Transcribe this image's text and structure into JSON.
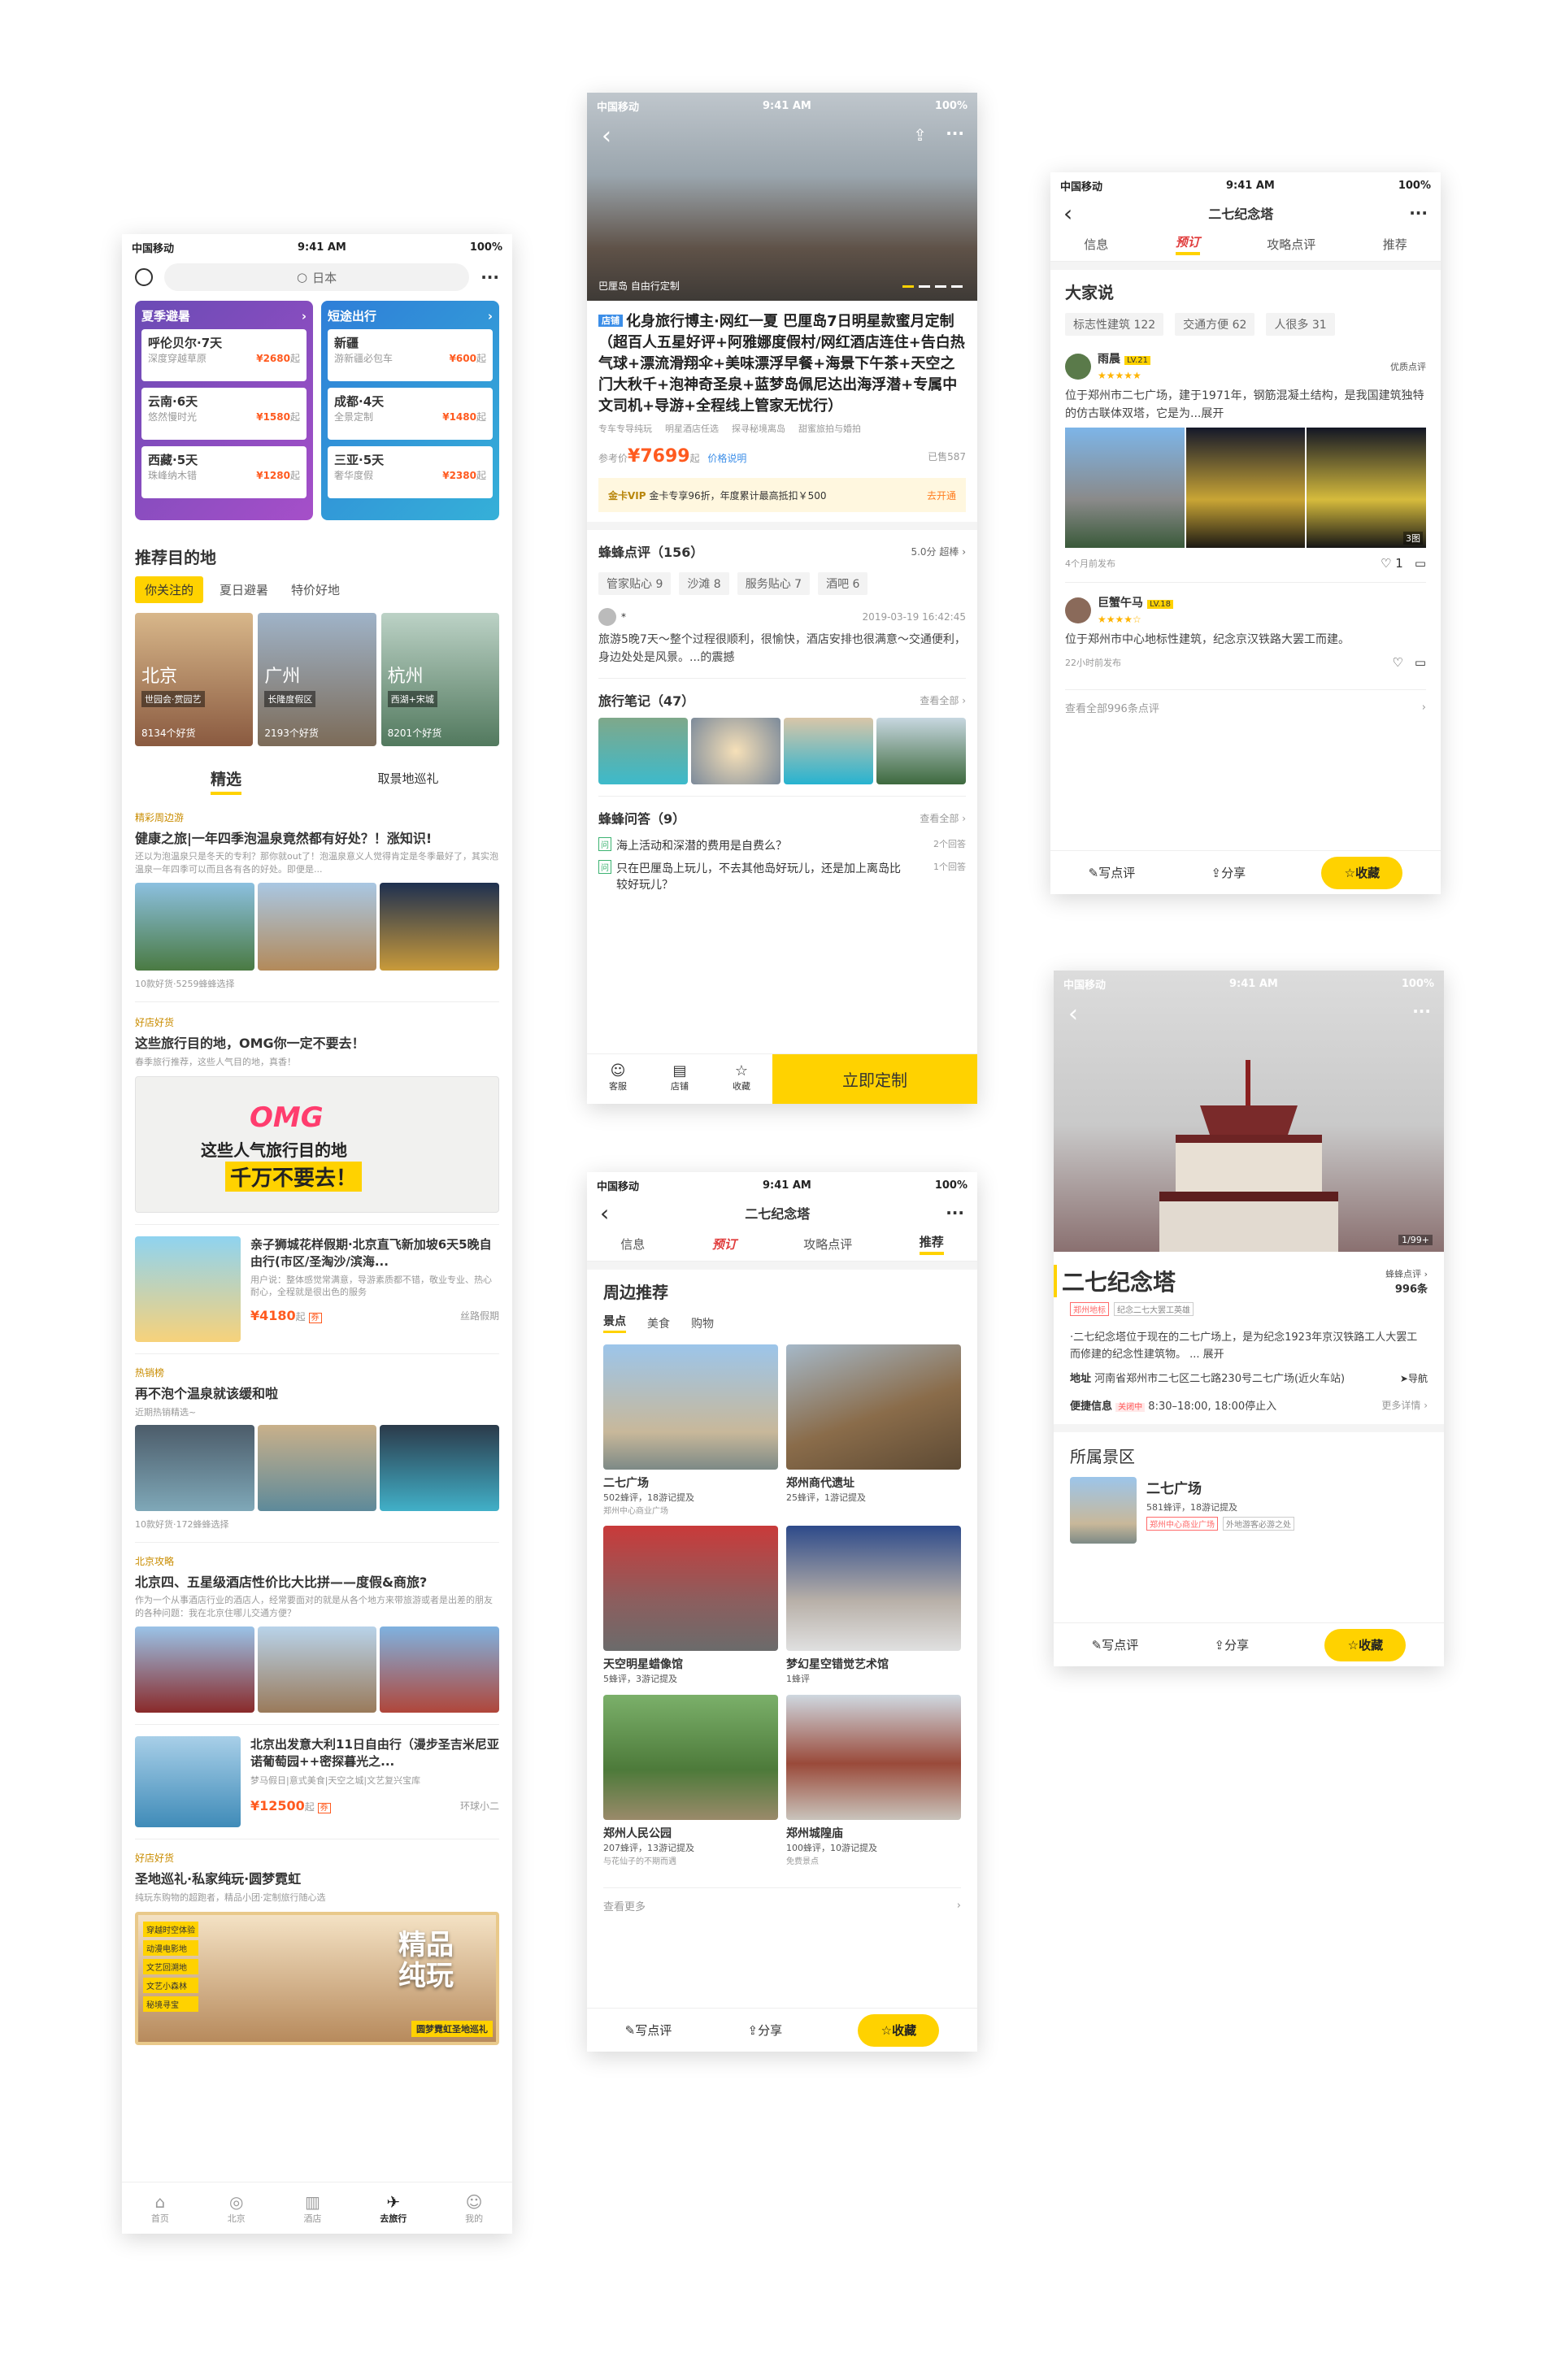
{
  "colors": {
    "accent": "#ffd200",
    "price": "#ff5a1f",
    "blue_tag": "#3c8ee8",
    "muted": "#9a9a9a"
  },
  "status": {
    "carrier": "中国移动",
    "time": "9:41 AM",
    "battery": "100%"
  },
  "screen1": {
    "search_placeholder": "日本",
    "more": "···",
    "cards": [
      {
        "title": "夏季避暑",
        "items": [
          {
            "name": "呼伦贝尔·7天",
            "desc": "深度穿越草原",
            "price": "¥2680",
            "unit": "起"
          },
          {
            "name": "云南·6天",
            "desc": "悠然慢时光",
            "price": "¥1580",
            "unit": "起"
          },
          {
            "name": "西藏·5天",
            "desc": "珠峰纳木错",
            "price": "¥1280",
            "unit": "起"
          }
        ]
      },
      {
        "title": "短途出行",
        "items": [
          {
            "name": "新疆",
            "desc": "游新疆必包车",
            "price": "¥600",
            "unit": "起"
          },
          {
            "name": "成都·4天",
            "desc": "全景定制",
            "price": "¥1480",
            "unit": "起"
          },
          {
            "name": "三亚·5天",
            "desc": "奢华度假",
            "price": "¥2380",
            "unit": "起"
          }
        ]
      }
    ],
    "recommend_title": "推荐目的地",
    "rec_tabs": [
      "你关注的",
      "夏日避暑",
      "特价好地"
    ],
    "destinations": [
      {
        "city": "北京",
        "tag": "世园会·赏园艺",
        "count": "8134个好货"
      },
      {
        "city": "广州",
        "tag": "长隆度假区",
        "count": "2193个好货"
      },
      {
        "city": "杭州",
        "tag": "西湖+宋城",
        "count": "8201个好货"
      }
    ],
    "feed_tabs": [
      "精选",
      "取景地巡礼"
    ],
    "feed": [
      {
        "tag": "精彩周边游",
        "title": "健康之旅|一年四季泡温泉竟然都有好处？！涨知识!",
        "desc": "还以为泡温泉只是冬天的专利？那你就out了！泡温泉意义人觉得肯定是冬季最好了，其实泡温泉一年四季可以而且各有各的好处。即便是...",
        "meta": "10款好货·5259蜂蜂选择"
      },
      {
        "tag": "好店好货",
        "title": "这些旅行目的地，OMG你一定不要去！",
        "desc": "春季旅行推荐，这些人气目的地，真香！",
        "banner1": "这些人气旅行目的地",
        "banner2": "千万不要去！",
        "omg": "OMG"
      },
      {
        "title": "亲子狮城花样假期·北京直飞新加坡6天5晚自由行(市区/圣淘沙/滨海...",
        "desc": "用户说：整体感觉常满意，导游素质都不错，敬业专业、热心耐心，全程就是很出色的服务",
        "price": "¥4180",
        "unit": "起",
        "badge": "券",
        "shop": "丝路假期"
      },
      {
        "tag": "热销榜",
        "title": "再不泡个温泉就该缓和啦",
        "desc": "近期热销精选~",
        "meta": "10款好货·172蜂蜂选择"
      },
      {
        "tag": "北京攻略",
        "title": "北京四、五星级酒店性价比大比拼——度假&商旅?",
        "desc": "作为一个从事酒店行业的酒店人，经常要面对的就是从各个地方来带旅游或者是出差的朋友的各种问题：我在北京住哪儿交通方便？"
      },
      {
        "title": "北京出发意大利11日自由行（漫步圣吉米尼亚诺葡萄园++密探暮光之...",
        "desc": "梦马假日|意式美食|天空之城|文艺复兴宝库",
        "price": "¥12500",
        "unit": "起",
        "badge": "券",
        "shop": "环球小二"
      },
      {
        "tag": "好店好货",
        "title": "圣地巡礼·私家纯玩·圆梦霓虹",
        "desc": "纯玩东购物的超跑者，精品小团·定制旅行随心选",
        "menu": [
          "穿越时空体验",
          "动漫电影地",
          "文艺回溯地",
          "文艺小森林",
          "秘境寻宝"
        ],
        "big": "精品纯玩",
        "banner": "圆梦霓虹圣地巡礼"
      }
    ],
    "nav": [
      "首页",
      "北京",
      "酒店",
      "去旅行",
      "我的"
    ]
  },
  "screen2": {
    "hero_caption": "巴厘岛 自由行定制",
    "title_badge": "店铺",
    "title": "化身旅行博主·网红一夏 巴厘岛7日明星款蜜月定制（超百人五星好评+阿雅娜度假村/网红酒店连住+告白热气球+漂流滑翔伞+美味漂浮早餐+海景下午茶+天空之门大秋千+泡神奇圣泉+蓝梦岛佩尼达出海浮潜+专属中文司机+导游+全程线上管家无忧行）",
    "tags": [
      "专车专导纯玩",
      "明星酒店任选",
      "探寻秘境离岛",
      "甜蜜旅拍与婚拍"
    ],
    "ref_label": "参考价",
    "price": "¥7699",
    "unit": "起",
    "price_link": "价格说明",
    "sold": "已售587",
    "vip_label": "金卡VIP",
    "vip_text": "金卡专享96折，年度累计最高抵扣￥500",
    "vip_link": "去开通",
    "review_title": "蜂蜂点评（156）",
    "review_score": "5.0分",
    "review_level": "超棒",
    "review_chips": [
      "管家贴心 9",
      "沙滩 8",
      "服务贴心 7",
      "酒吧 6"
    ],
    "review_user": "*",
    "review_time": "2019-03-19 16:42:45",
    "review_text": "旅游5晚7天～整个过程很顺利，很愉快，酒店安排也很满意～交通便利，身边处处是风景。...的震撼",
    "notes_title": "旅行笔记（47）",
    "see_all": "查看全部",
    "qa_title": "蜂蜂问答（9）",
    "qa": [
      {
        "badge": "问",
        "q": "海上活动和深潜的费用是自费么？",
        "count": "2个回答"
      },
      {
        "badge": "问",
        "q": "只在巴厘岛上玩儿，不去其他岛好玩儿，还是加上离岛比较好玩儿？",
        "count": "1个回答"
      }
    ],
    "bottom": [
      "客服",
      "店铺",
      "收藏"
    ],
    "cta": "立即定制"
  },
  "screen3": {
    "title": "二七纪念塔",
    "tabs": [
      "信息",
      "预订",
      "攻略点评",
      "推荐"
    ],
    "section": "周边推荐",
    "subtabs": [
      "景点",
      "美食",
      "购物"
    ],
    "items": [
      {
        "name": "二七广场",
        "stats": "502蜂评，18游记提及",
        "desc": "郑州中心商业广场"
      },
      {
        "name": "郑州商代遗址",
        "stats": "25蜂评，1游记提及",
        "desc": ""
      },
      {
        "name": "天空明星蜡像馆",
        "stats": "5蜂评，3游记提及",
        "desc": ""
      },
      {
        "name": "梦幻星空错觉艺术馆",
        "stats": "1蜂评",
        "desc": ""
      },
      {
        "name": "郑州人民公园",
        "stats": "207蜂评，13游记提及",
        "desc": "与花仙子的不期而遇"
      },
      {
        "name": "郑州城隍庙",
        "stats": "100蜂评，10游记提及",
        "desc": "免费景点"
      }
    ],
    "more": "查看更多",
    "bottom": {
      "comment": "写点评",
      "share": "分享",
      "fav": "收藏"
    }
  },
  "screen4": {
    "title": "二七纪念塔",
    "tabs": [
      "信息",
      "预订",
      "攻略点评",
      "推荐"
    ],
    "section": "大家说",
    "chips": [
      "标志性建筑 122",
      "交通方便 62",
      "人很多 31"
    ],
    "reviews": [
      {
        "user": "雨晨",
        "level": "LV.21",
        "badge": "优质点评",
        "text": "位于郑州市二七广场，建于1971年，钢筋混凝土结构，是我国建筑独特的仿古联体双塔，它是为...展开",
        "time": "4个月前发布",
        "img_count": "3图",
        "likes": "1"
      },
      {
        "user": "巨蟹午马",
        "level": "LV.18",
        "text": "位于郑州市中心地标性建筑，纪念京汉铁路大罢工而建。",
        "time": "22小时前发布"
      }
    ],
    "see_all": "查看全部996条点评",
    "bottom": {
      "comment": "写点评",
      "share": "分享",
      "fav": "收藏"
    }
  },
  "screen5": {
    "photo_count": "1/99+",
    "title": "二七纪念塔",
    "score_label": "蜂蜂点评",
    "score_count": "996条",
    "tags": [
      "郑州地标",
      "纪念二七大罢工英雄"
    ],
    "desc": "·二七纪念塔位于现在的二七广场上，是为纪念1923年京汉铁路工人大罢工而修建的纪念性建筑物。 ... 展开",
    "addr_label": "地址",
    "addr": "河南省郑州市二七区二七路230号二七广场(近火车站)",
    "nav": "导航",
    "info_label": "便捷信息",
    "closed": "关闭中",
    "hours": "8:30–18:00, 18:00停止入",
    "more": "更多详情",
    "area_title": "所属景区",
    "area_name": "二七广场",
    "area_stats": "581蜂评，18游记提及",
    "area_tags": [
      "郑州中心商业广场",
      "外地游客必游之处"
    ],
    "bottom": {
      "comment": "写点评",
      "share": "分享",
      "fav": "收藏"
    }
  }
}
